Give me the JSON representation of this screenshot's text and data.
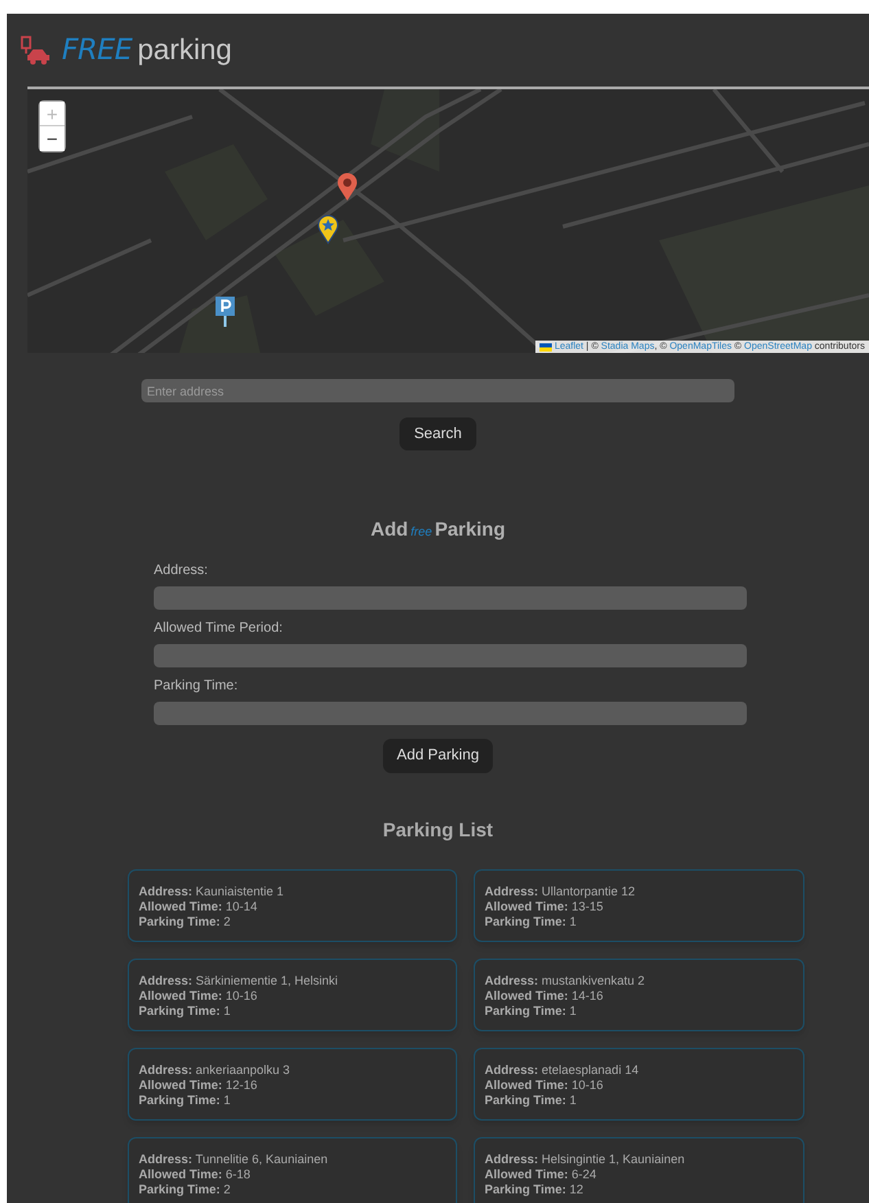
{
  "logo": {
    "accent": "FREE",
    "text": "parking"
  },
  "map": {
    "kind": "picture",
    "zoom_in": "+",
    "zoom_out": "−",
    "attribution": [
      {
        "text": "Leaflet",
        "link": true
      },
      {
        "text": " | © ",
        "link": false
      },
      {
        "text": "Stadia Maps",
        "link": true
      },
      {
        "text": ", © ",
        "link": false
      },
      {
        "text": "OpenMapTiles",
        "link": true
      },
      {
        "text": " © ",
        "link": false
      },
      {
        "text": "OpenStreetMap",
        "link": true
      },
      {
        "text": " contributors",
        "link": false
      }
    ]
  },
  "search": {
    "placeholder": "Enter address",
    "button": "Search"
  },
  "add_form": {
    "title_before": "Add",
    "title_accent": "free",
    "title_after": "Parking",
    "fields": [
      {
        "label": "Address:"
      },
      {
        "label": "Allowed Time Period:"
      },
      {
        "label": "Parking Time:"
      }
    ],
    "button": "Add Parking"
  },
  "parking_list": {
    "title": "Parking List",
    "items": [
      {
        "lines": [
          "**Address:** Kauniaistentie 1",
          "**Allowed Time:** 10-14",
          "**Parking Time:** 2"
        ]
      },
      {
        "lines": [
          "**Address:** Ullantorpantie 12",
          "**Allowed Time:** 13-15",
          "**Parking Time:** 1"
        ]
      },
      {
        "lines": [
          "**Address:** Särkiniementie 1, Helsinki",
          "**Allowed Time:** 10-16",
          "**Parking Time:** 1"
        ]
      },
      {
        "lines": [
          "**Address:** mustankivenkatu 2",
          "**Allowed Time:** 14-16",
          "**Parking Time:** 1"
        ]
      },
      {
        "lines": [
          "**Address:** ankeriaanpolku 3",
          "**Allowed Time:** 12-16",
          "**Parking Time:** 1"
        ]
      },
      {
        "lines": [
          "**Address:** etelaesplanadi 14",
          "**Allowed Time:** 10-16",
          "**Parking Time:** 1"
        ]
      },
      {
        "lines": [
          "**Address:** Tunnelitie 6, Kauniainen",
          "**Allowed Time:** 6-18",
          "**Parking Time:** 2"
        ]
      },
      {
        "lines": [
          "**Address:** Helsingintie 1, Kauniainen",
          "**Allowed Time:** 6-24",
          "**Parking Time:** 12"
        ]
      }
    ]
  }
}
